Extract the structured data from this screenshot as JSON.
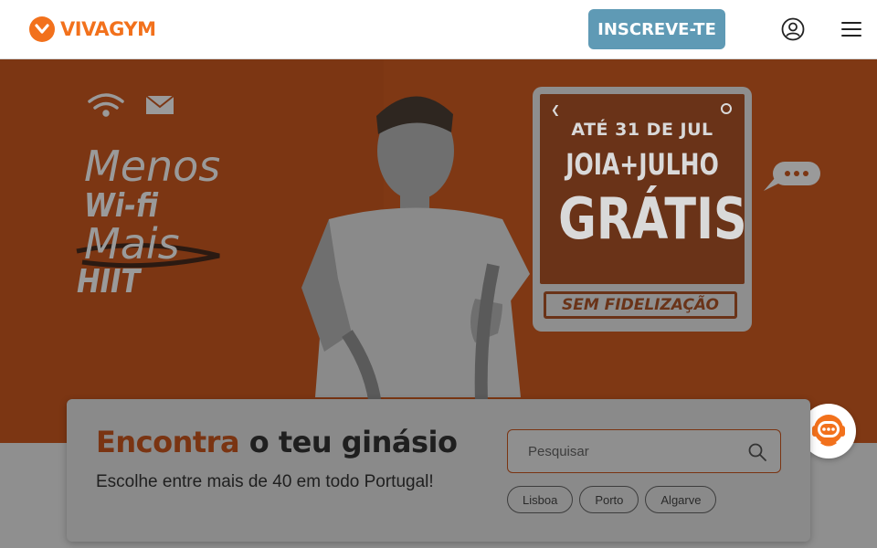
{
  "header": {
    "logo_text": "VIVAGYM",
    "signup_label": "INSCREVE-TE",
    "icons": {
      "logo": "heart-chevron-icon",
      "user": "user-circle-icon",
      "menu": "hamburger-menu-icon"
    }
  },
  "hero": {
    "tagline": [
      "Menos",
      "Wi-fi",
      "Mais",
      "HIIT"
    ],
    "promo": {
      "line1": "ATÉ 31 DE JUL",
      "line2": "JOIA+JULHO",
      "line3": "GRÁTIS",
      "badge": "SEM FIDELIZAÇÃO"
    },
    "icons": {
      "wifi": "wifi-icon",
      "mail": "mail-icon",
      "chat_bubble": "chat-bubble-icon"
    }
  },
  "finder": {
    "title_accent": "Encontra",
    "title_rest": " o teu ginásio",
    "subtitle": "Escolhe entre mais de 40 em todo Portugal!",
    "search_placeholder": "Pesquisar",
    "chips": [
      "Lisboa",
      "Porto",
      "Algarve"
    ]
  },
  "chat_widget": {
    "icon": "support-agent-icon"
  },
  "colors": {
    "brand_orange": "#f2711c",
    "button_blue": "#5f9ab5",
    "overlay_grey": "#8f8f8f"
  }
}
